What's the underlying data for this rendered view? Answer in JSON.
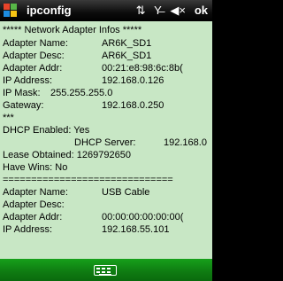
{
  "window": {
    "title": "ipconfig",
    "ok_label": "ok",
    "status_icons": [
      "connectivity-icon",
      "no-signal-icon",
      "speaker-icon"
    ]
  },
  "lines": [
    {
      "text": "***** Network Adapter Infos *****",
      "value": ""
    },
    {
      "text": "Adapter Name:",
      "value": "AR6K_SD1"
    },
    {
      "text": "Adapter Desc:",
      "value": "AR6K_SD1"
    },
    {
      "text": "Adapter Addr:",
      "value": "00:21:e8:98:6c:8b("
    },
    {
      "text": "IP Address:",
      "value": "192.168.0.126"
    },
    {
      "text": "IP Mask:",
      "value": "255.255.255.0"
    },
    {
      "text": "Gateway:",
      "value": "192.168.0.250"
    },
    {
      "text": "***",
      "value": ""
    },
    {
      "text": "DHCP Enabled: Yes",
      "value": ""
    },
    {
      "text": "DHCP Server:",
      "value": "192.168.0"
    },
    {
      "text": "Lease Obtained: 1269792650",
      "value": ""
    },
    {
      "text": "Have Wins: No",
      "value": ""
    },
    {
      "text": "==============================",
      "value": ""
    },
    {
      "text": "Adapter Name:",
      "value": "USB Cable"
    },
    {
      "text": "Adapter Desc:",
      "value": ""
    },
    {
      "text": "Adapter Addr:",
      "value": "00:00:00:00:00:00("
    },
    {
      "text": "IP Address:",
      "value": "192.168.55.101"
    }
  ],
  "colors": {
    "content_bg": "#c8e7c5",
    "bottom_bar": "#129014",
    "title_bar": "#000000"
  }
}
